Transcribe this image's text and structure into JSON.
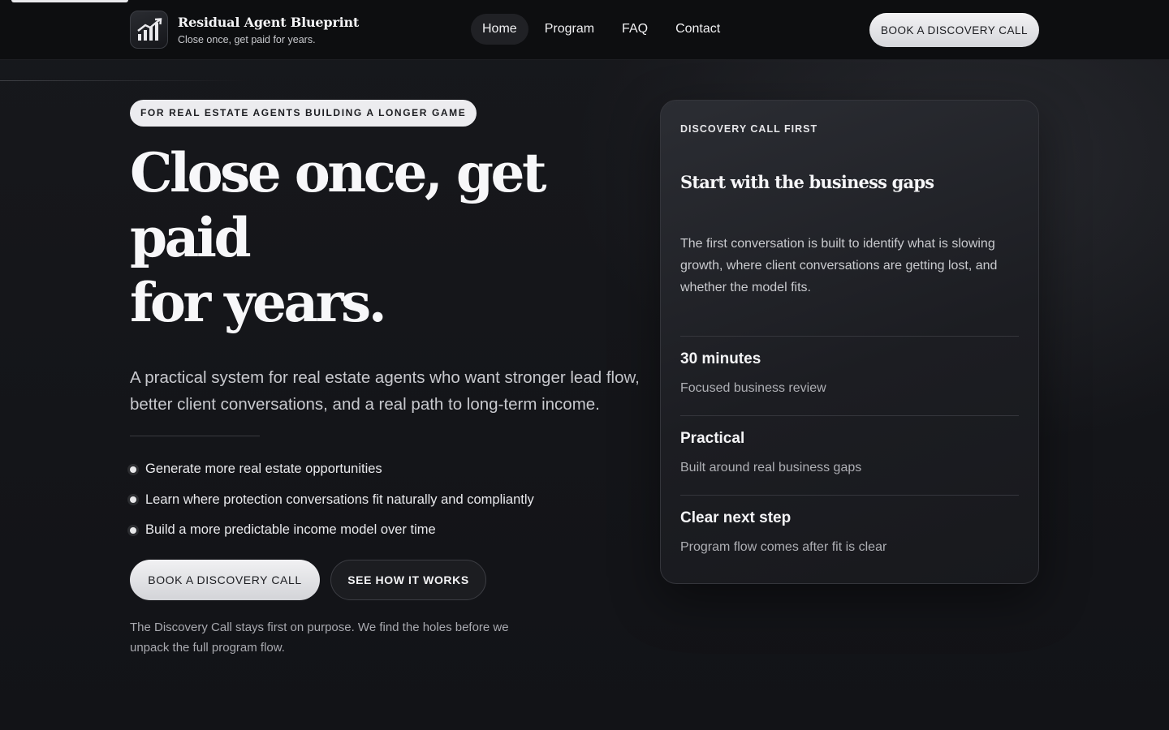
{
  "brand": {
    "name": "Residual Agent Blueprint",
    "tagline": "Close once, get paid for years."
  },
  "nav": {
    "items": [
      {
        "label": "Home",
        "active": true
      },
      {
        "label": "Program",
        "active": false
      },
      {
        "label": "FAQ",
        "active": false
      },
      {
        "label": "Contact",
        "active": false
      }
    ],
    "cta_label": "BOOK A DISCOVERY CALL"
  },
  "hero": {
    "eyebrow": "FOR REAL ESTATE AGENTS BUILDING A LONGER GAME",
    "headline_line1": "Close once, get paid",
    "headline_line2": "for years.",
    "lede": "A practical system for real estate agents who want stronger lead flow, better client conversations, and a real path to long-term income.",
    "bullets": [
      "Generate more real estate opportunities",
      "Learn where protection conversations fit naturally and compliantly",
      "Build a more predictable income model over time"
    ],
    "primary_cta": "BOOK A DISCOVERY CALL",
    "secondary_cta": "SEE HOW IT WORKS",
    "footnote": "The Discovery Call stays first on purpose. We find the holes before we unpack the full program flow."
  },
  "card": {
    "eyebrow": "DISCOVERY CALL FIRST",
    "title": "Start with the business gaps",
    "body": "The first conversation is built to identify what is slowing growth, where client conversations are getting lost, and whether the model fits.",
    "stats": [
      {
        "title": "30 minutes",
        "subtitle": "Focused business review"
      },
      {
        "title": "Practical",
        "subtitle": "Built around real business gaps"
      },
      {
        "title": "Clear next step",
        "subtitle": "Program flow comes after fit is clear"
      }
    ]
  },
  "icons": {
    "brand_logo": "rising-chart-icon",
    "bullet": "bullet-dot-icon"
  },
  "colors": {
    "background": "#131417",
    "header": "#0d0e10",
    "accent_light": "#ececef",
    "text_primary": "#f2f2f4",
    "text_muted": "#a9aab0"
  }
}
